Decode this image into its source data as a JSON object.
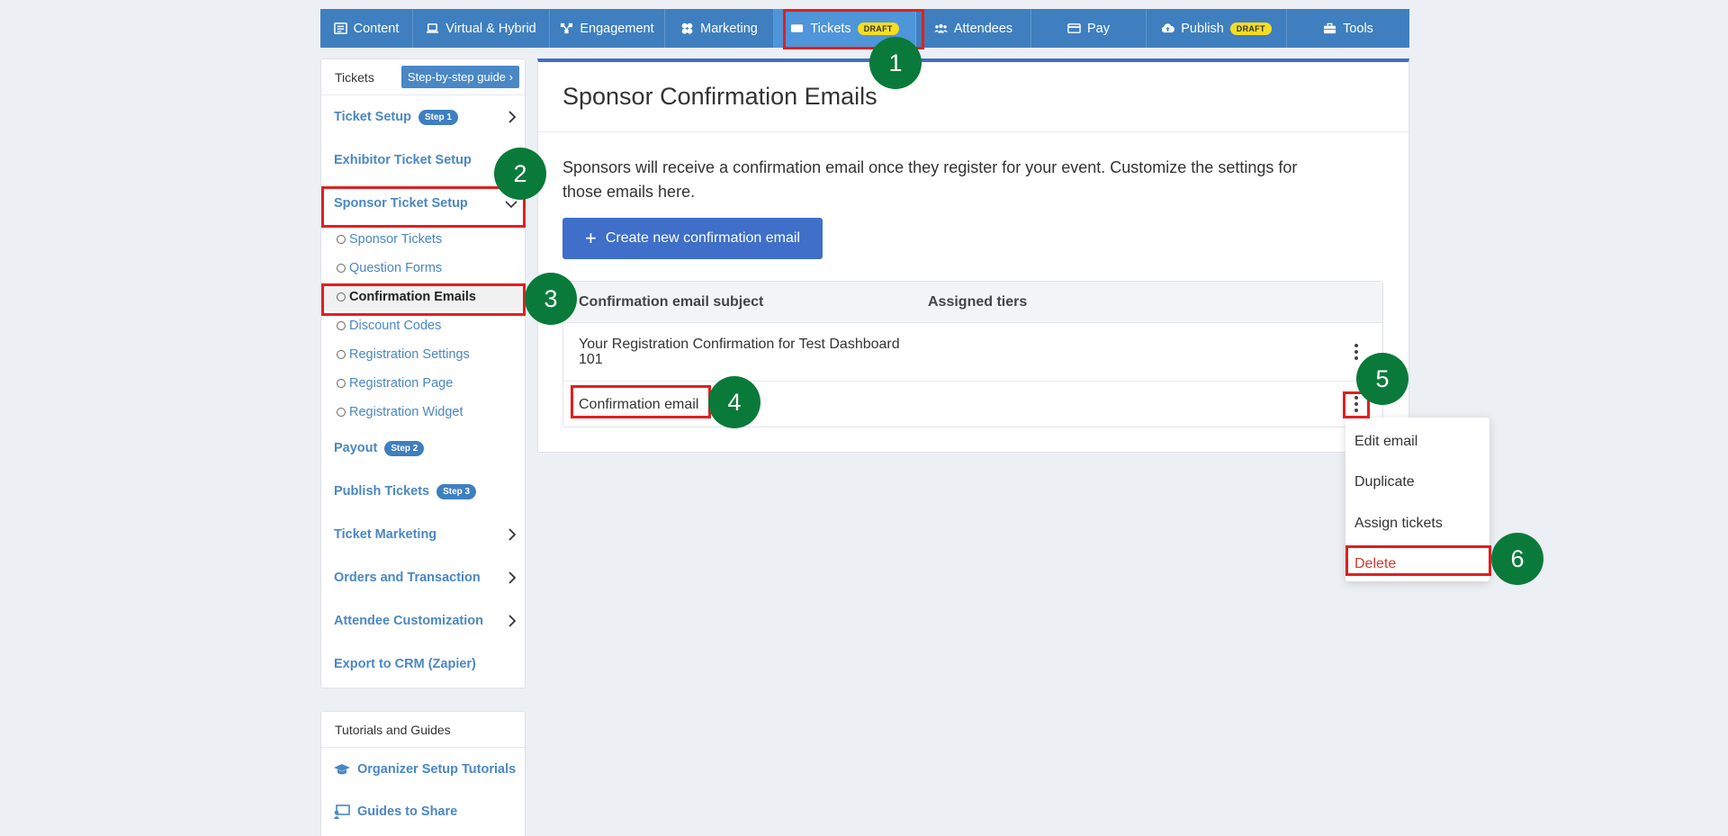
{
  "topnav": {
    "items": [
      {
        "label": "Content",
        "icon": "content-icon"
      },
      {
        "label": "Virtual & Hybrid",
        "icon": "laptop-icon"
      },
      {
        "label": "Engagement",
        "icon": "engagement-icon"
      },
      {
        "label": "Marketing",
        "icon": "marketing-icon"
      },
      {
        "label": "Tickets",
        "icon": "ticket-icon",
        "badge": "DRAFT"
      },
      {
        "label": "Attendees",
        "icon": "people-icon"
      },
      {
        "label": "Pay",
        "icon": "card-icon"
      },
      {
        "label": "Publish",
        "icon": "cloud-upload-icon",
        "badge": "DRAFT"
      },
      {
        "label": "Tools",
        "icon": "toolbox-icon"
      }
    ]
  },
  "sidebar": {
    "title": "Tickets",
    "guide_button": "Step-by-step guide",
    "ticket_setup": {
      "label": "Ticket Setup",
      "step": "Step 1"
    },
    "exhibitor": "Exhibitor Ticket Setup",
    "sponsor": "Sponsor Ticket Setup",
    "sub_items": [
      "Sponsor Tickets",
      "Question Forms",
      "Confirmation Emails",
      "Discount Codes",
      "Registration Settings",
      "Registration Page",
      "Registration Widget"
    ],
    "payout": {
      "label": "Payout",
      "step": "Step 2"
    },
    "publish": {
      "label": "Publish Tickets",
      "step": "Step 3"
    },
    "ticket_marketing": "Ticket Marketing",
    "orders": "Orders and Transaction",
    "attendee_custom": "Attendee Customization",
    "export": "Export to CRM (Zapier)"
  },
  "sidebar2": {
    "title": "Tutorials and Guides",
    "items": [
      "Organizer Setup Tutorials",
      "Guides to Share"
    ]
  },
  "main": {
    "title": "Sponsor Confirmation Emails",
    "description": "Sponsors will receive a confirmation email once they register for your event. Customize the settings for those emails here.",
    "create_button": "Create new confirmation email",
    "table": {
      "headers": [
        "Confirmation email subject",
        "Assigned tiers"
      ],
      "rows": [
        {
          "subject": "Your Registration Confirmation for Test Dashboard 101",
          "tiers": ""
        },
        {
          "subject": "Confirmation email",
          "tiers": ""
        }
      ]
    }
  },
  "dropdown": {
    "items": [
      "Edit email",
      "Duplicate",
      "Assign tickets",
      "Delete"
    ]
  },
  "annotations": [
    "1",
    "2",
    "3",
    "4",
    "5",
    "6"
  ],
  "colors": {
    "nav_bg": "#3f7fbf",
    "primary_button": "#3f6fc8",
    "link": "#4a87c5",
    "badge_green": "#0a7a3a",
    "highlight_red": "#e02020",
    "delete_red": "#d9382e",
    "draft_yellow": "#f5dd20"
  }
}
